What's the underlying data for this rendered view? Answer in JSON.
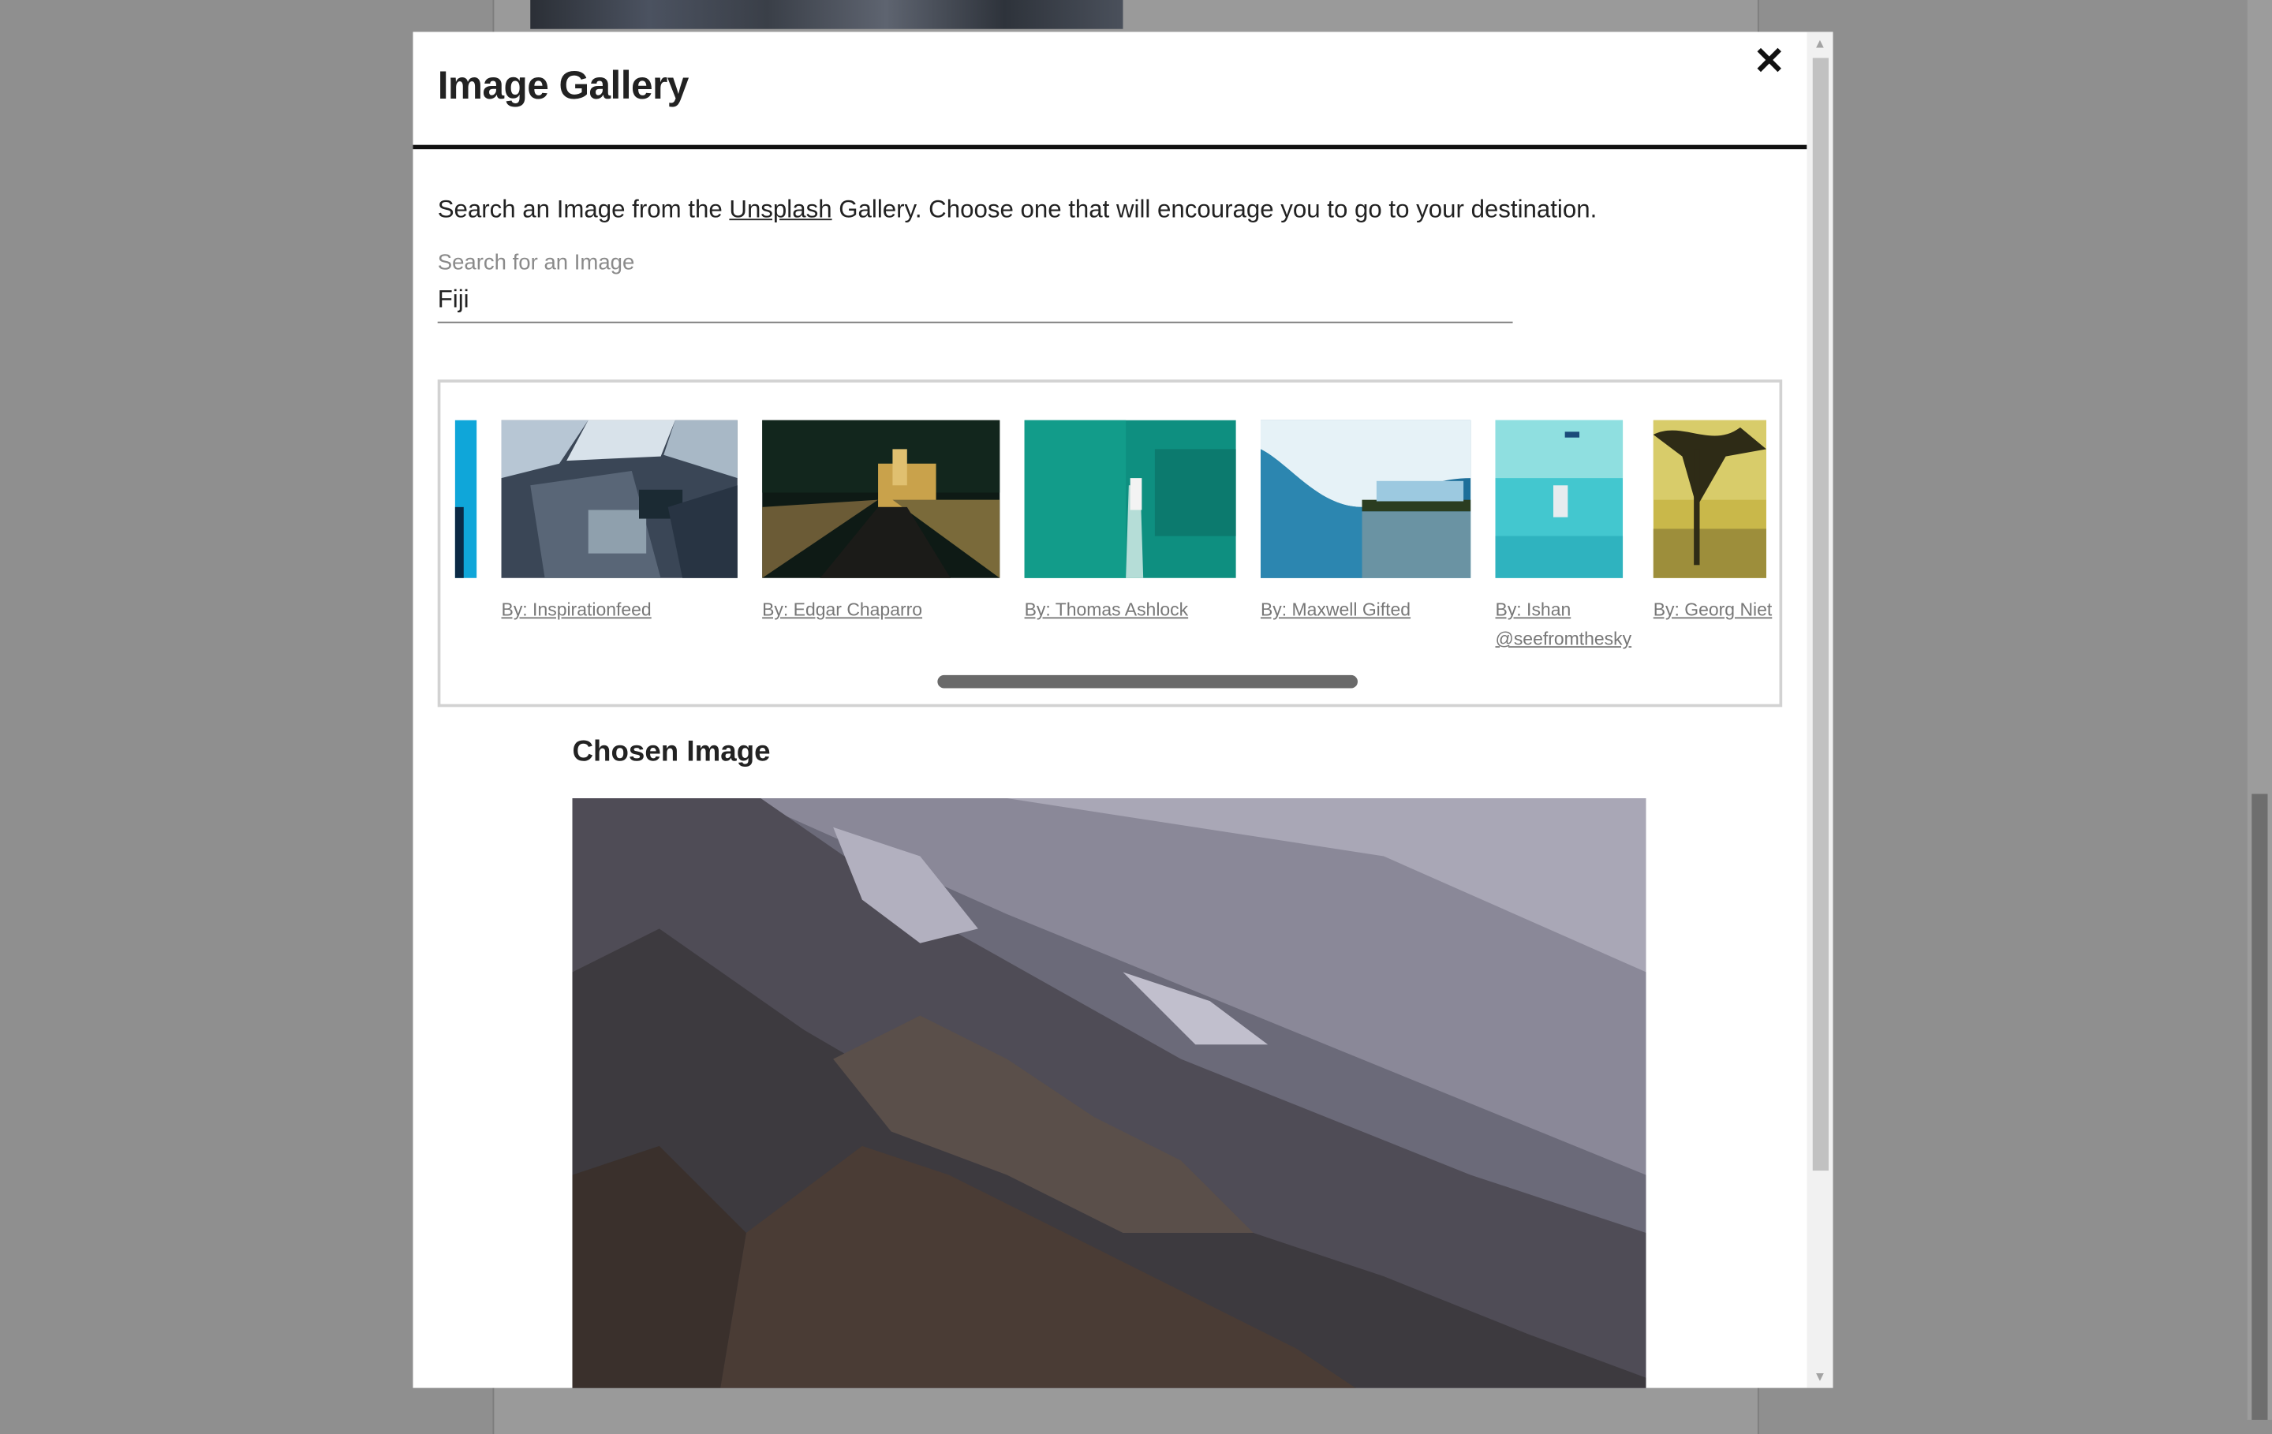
{
  "modal": {
    "title": "Image Gallery",
    "close_icon": "close-icon"
  },
  "intro": {
    "before": "Search an Image from the ",
    "link": "Unsplash",
    "after": " Gallery. Choose one that will encourage you to go to your destination."
  },
  "search": {
    "label": "Search for an Image",
    "value": "Fiji"
  },
  "gallery": {
    "items": [
      {
        "caption": "By: Inspirationfeed",
        "icon": "cockpit-photo"
      },
      {
        "caption": "By: Edgar Chaparro",
        "icon": "city-night-photo"
      },
      {
        "caption": "By: Thomas Ashlock",
        "icon": "boat-ocean-photo"
      },
      {
        "caption": "By: Maxwell Gifted",
        "icon": "wave-barrel-photo"
      },
      {
        "caption_line1": "By: Ishan",
        "caption_line2": "@seefromthesky",
        "icon": "aerial-beach-photo"
      },
      {
        "caption": "By: Georg Niet",
        "icon": "palm-sunset-photo"
      }
    ]
  },
  "chosen": {
    "title": "Chosen Image",
    "icon": "volcanic-slope-photo"
  }
}
